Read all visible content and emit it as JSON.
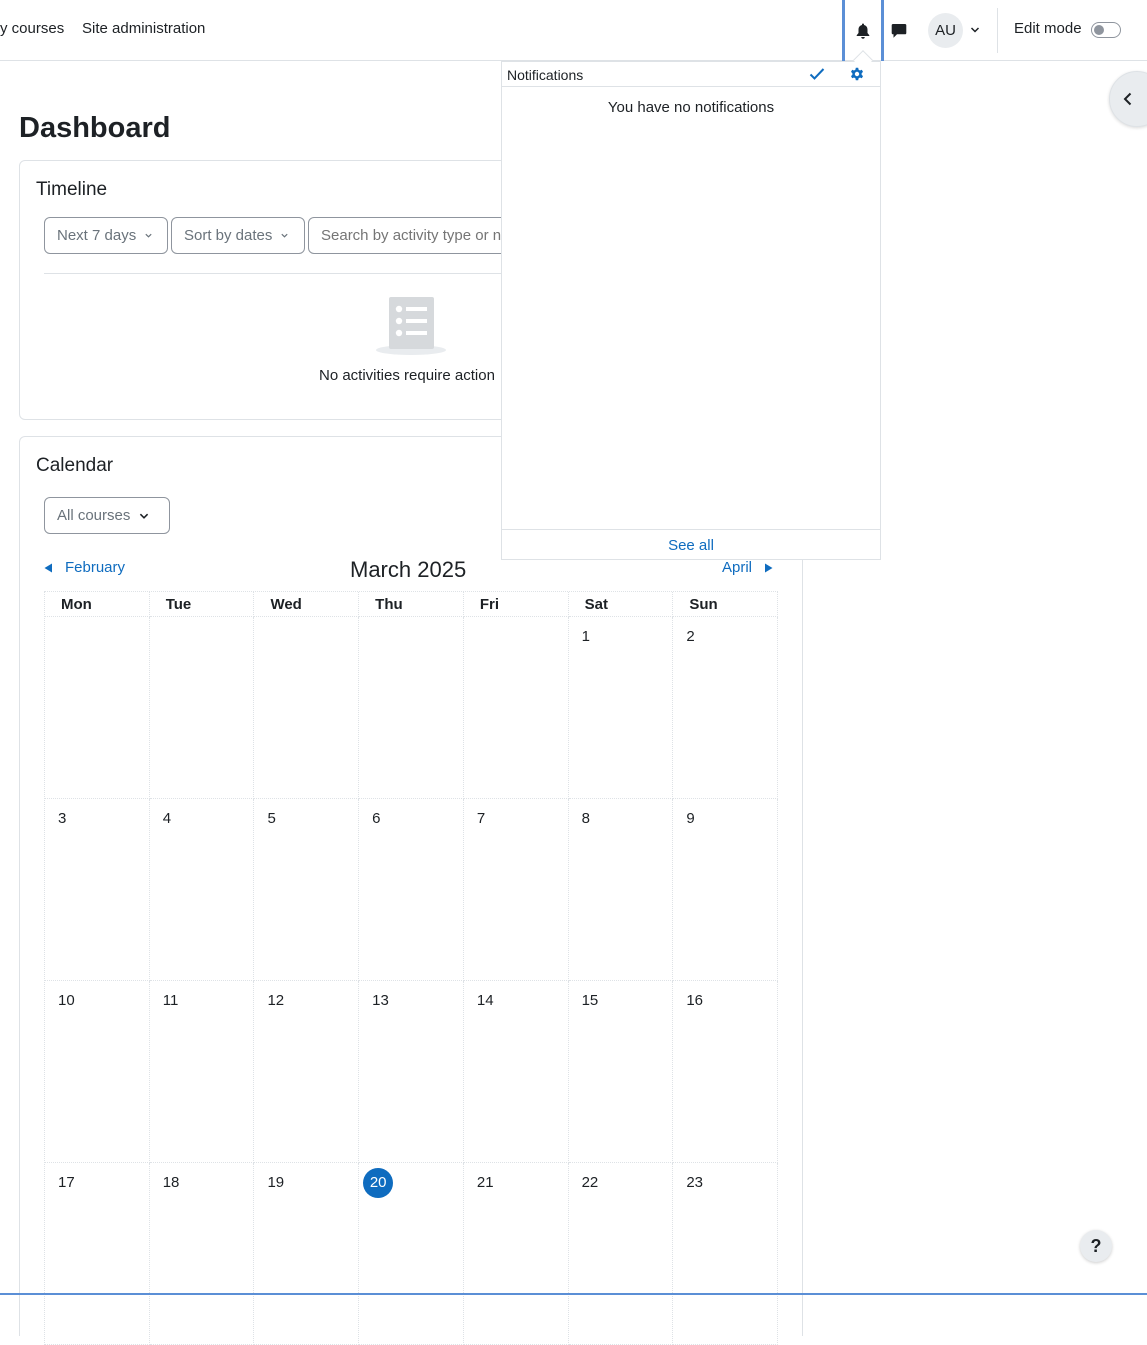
{
  "navbar": {
    "links": [
      "y courses",
      "Site administration"
    ],
    "avatar_initials": "AU",
    "edit_mode_label": "Edit mode",
    "icons": {
      "notifications": "bell-icon",
      "messages": "chat-bubble-icon",
      "user_menu_caret": "chevron-down-icon"
    }
  },
  "page": {
    "title": "Dashboard"
  },
  "timeline": {
    "title": "Timeline",
    "filter_label": "Next 7 days",
    "sort_label": "Sort by dates",
    "search_placeholder": "Search by activity type or name",
    "empty_text": "No activities require action"
  },
  "calendar": {
    "title": "Calendar",
    "course_filter": "All courses",
    "prev_month": "February",
    "next_month": "April",
    "month_title": "March 2025",
    "weekdays": [
      "Mon",
      "Tue",
      "Wed",
      "Thu",
      "Fri",
      "Sat",
      "Sun"
    ],
    "weeks": [
      [
        "",
        "",
        "",
        "",
        "",
        "1",
        "2"
      ],
      [
        "3",
        "4",
        "5",
        "6",
        "7",
        "8",
        "9"
      ],
      [
        "10",
        "11",
        "12",
        "13",
        "14",
        "15",
        "16"
      ],
      [
        "17",
        "18",
        "19",
        "20",
        "21",
        "22",
        "23"
      ]
    ],
    "today": "20"
  },
  "notifications": {
    "title": "Notifications",
    "empty_text": "You have no notifications",
    "see_all": "See all"
  },
  "help": {
    "label": "?"
  },
  "colors": {
    "accent": "#0f6cbf",
    "focus_border": "#5b8fd6",
    "text": "#1d2125",
    "border": "#dee2e6"
  }
}
